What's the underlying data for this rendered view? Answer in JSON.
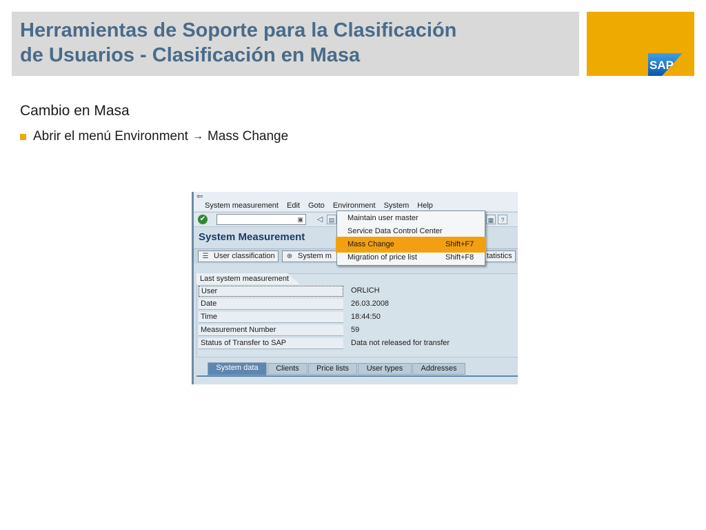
{
  "slide": {
    "title_line1": "Herramientas de Soporte para la Clasificación",
    "title_line2": "de Usuarios - Clasificación en Masa",
    "subtitle": "Cambio en Masa",
    "bullet_prefix": "Abrir el menú Environment",
    "bullet_arrow": "→",
    "bullet_suffix": "Mass Change",
    "logo_text": "SAP",
    "colors": {
      "title": "#4a6b8a",
      "accent": "#efaa00",
      "header_bg": "#d9d9d9"
    }
  },
  "sap": {
    "menu": [
      "System measurement",
      "Edit",
      "Goto",
      "Environment",
      "System",
      "Help"
    ],
    "screen_title": "System Measurement",
    "app_buttons": {
      "user_classification": "User classification",
      "system_measurement": "System m",
      "statistics": "tatistics"
    },
    "group_title": "Last system measurement",
    "fields": [
      {
        "label": "User",
        "value": "ORLICH"
      },
      {
        "label": "Date",
        "value": "26.03.2008"
      },
      {
        "label": "Time",
        "value": "18:44:50"
      },
      {
        "label": "Measurement Number",
        "value": "59"
      },
      {
        "label": "Status of Transfer to SAP",
        "value": "Data not released for transfer"
      }
    ],
    "tabs": [
      "System data",
      "Clients",
      "Price lists",
      "User types",
      "Addresses"
    ],
    "dropdown": [
      {
        "label": "Maintain user master",
        "shortcut": ""
      },
      {
        "label": "Service Data Control Center",
        "shortcut": ""
      },
      {
        "label": "Mass Change",
        "shortcut": "Shift+F7"
      },
      {
        "label": "Migration of price list",
        "shortcut": "Shift+F8"
      }
    ],
    "icons": [
      "enter-icon",
      "ok-check-icon",
      "dropdown-icon",
      "back-icon",
      "save-icon",
      "help-icon",
      "layout-icon",
      "list-icon",
      "measure-icon"
    ]
  }
}
